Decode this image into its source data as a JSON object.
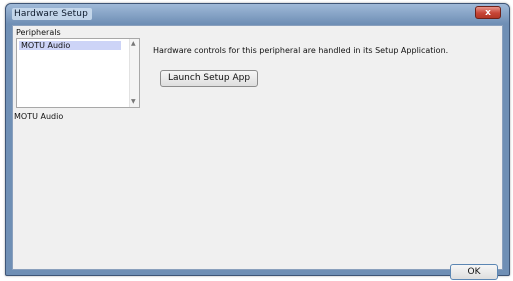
{
  "window": {
    "title": "Hardware Setup",
    "close_glyph": "x"
  },
  "left_panel": {
    "peripherals_label": "Peripherals",
    "items": [
      "MOTU Audio"
    ],
    "selected_label": "MOTU Audio"
  },
  "main": {
    "message": "Hardware controls for this peripheral are handled in its Setup Application.",
    "launch_button": "Launch Setup App"
  },
  "footer": {
    "ok_button": "OK"
  },
  "icons": {
    "scroll_up": "scroll-up-arrow-icon",
    "scroll_down": "scroll-down-arrow-icon"
  }
}
